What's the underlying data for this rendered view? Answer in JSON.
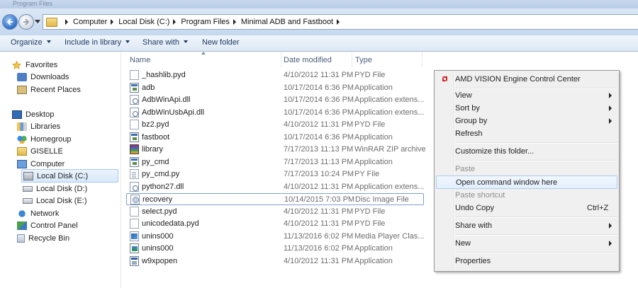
{
  "window": {
    "title": "Program Files"
  },
  "address": {
    "crumbs": [
      "Computer",
      "Local Disk (C:)",
      "Program Files",
      "Minimal ADB and Fastboot"
    ]
  },
  "toolbar": {
    "organize": "Organize",
    "include": "Include in library",
    "share": "Share with",
    "newfolder": "New folder"
  },
  "nav": {
    "favorites": "Favorites",
    "downloads": "Downloads",
    "recent": "Recent Places",
    "desktop": "Desktop",
    "libraries": "Libraries",
    "homegroup": "Homegroup",
    "user": "GISELLE",
    "computer": "Computer",
    "diskC": "Local Disk (C:)",
    "diskD": "Local Disk (D:)",
    "diskE": "Local Disk (E:)",
    "network": "Network",
    "control": "Control Panel",
    "recycle": "Recycle Bin"
  },
  "columns": {
    "name": "Name",
    "date": "Date modified",
    "type": "Type"
  },
  "files": [
    {
      "name": "_hashlib.pyd",
      "date": "4/10/2012 11:31 PM",
      "type": "PYD File",
      "icon": "doc-icon"
    },
    {
      "name": "adb",
      "date": "10/17/2014 6:36 PM",
      "type": "Application",
      "icon": "app-icon"
    },
    {
      "name": "AdbWinApi.dll",
      "date": "10/17/2014 6:36 PM",
      "type": "Application extens...",
      "icon": "dll-icon"
    },
    {
      "name": "AdbWinUsbApi.dll",
      "date": "10/17/2014 6:36 PM",
      "type": "Application extens...",
      "icon": "dll-icon"
    },
    {
      "name": "bz2.pyd",
      "date": "4/10/2012 11:31 PM",
      "type": "PYD File",
      "icon": "doc-icon"
    },
    {
      "name": "fastboot",
      "date": "10/17/2014 6:36 PM",
      "type": "Application",
      "icon": "app-icon"
    },
    {
      "name": "library",
      "date": "7/17/2013 11:13 PM",
      "type": "WinRAR ZIP archive",
      "icon": "rar-icon"
    },
    {
      "name": "py_cmd",
      "date": "7/17/2013 11:13 PM",
      "type": "Application",
      "icon": "app-icon"
    },
    {
      "name": "py_cmd.py",
      "date": "7/17/2013 10:24 PM",
      "type": "PY File",
      "icon": "py-icon"
    },
    {
      "name": "python27.dll",
      "date": "4/10/2012 11:31 PM",
      "type": "Application extens...",
      "icon": "dll-icon"
    },
    {
      "name": "recovery",
      "date": "10/14/2015 7:03 PM",
      "type": "Disc Image File",
      "icon": "disc-icon"
    },
    {
      "name": "select.pyd",
      "date": "4/10/2012 11:31 PM",
      "type": "PYD File",
      "icon": "doc-icon"
    },
    {
      "name": "unicodedata.pyd",
      "date": "4/10/2012 11:31 PM",
      "type": "PYD File",
      "icon": "doc-icon"
    },
    {
      "name": "unins000",
      "date": "11/13/2016 6:02 PM",
      "type": "Media Player Clas...",
      "icon": "media-icon"
    },
    {
      "name": "unins000",
      "date": "11/13/2016 6:02 PM",
      "type": "Application",
      "icon": "setup-icon"
    },
    {
      "name": "w9xpopen",
      "date": "4/10/2012 11:31 PM",
      "type": "Application",
      "icon": "w9x-icon"
    }
  ],
  "menu": {
    "amd": "AMD VISION Engine Control Center",
    "view": "View",
    "sortby": "Sort by",
    "groupby": "Group by",
    "refresh": "Refresh",
    "customize": "Customize this folder...",
    "paste": "Paste",
    "opencmd": "Open command window here",
    "pasteshortcut": "Paste shortcut",
    "undo": "Undo Copy",
    "undo_shortcut": "Ctrl+Z",
    "share": "Share with",
    "new": "New",
    "properties": "Properties"
  }
}
